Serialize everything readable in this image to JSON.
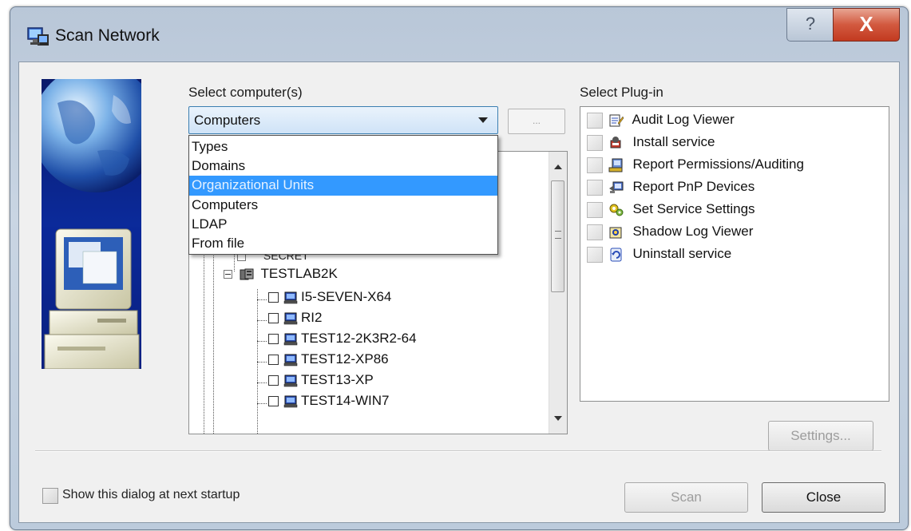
{
  "window": {
    "title": "Scan Network",
    "help_glyph": "?",
    "close_glyph": "X"
  },
  "computers": {
    "label": "Select computer(s)",
    "combo_value": "Computers",
    "browse_label": "...",
    "dropdown_options": [
      "Types",
      "Domains",
      "Organizational Units",
      "Computers",
      "LDAP",
      "From file"
    ],
    "selected_option": "Organizational Units",
    "tree": {
      "partial_node": "SECRET",
      "group": "TESTLAB2K",
      "computers": [
        "I5-SEVEN-X64",
        "RI2",
        "TEST12-2K3R2-64",
        "TEST12-XP86",
        "TEST13-XP",
        "TEST14-WIN7"
      ]
    }
  },
  "plugins": {
    "label": "Select Plug-in",
    "items": [
      {
        "label": "Audit Log Viewer",
        "icon": "audit-log-icon"
      },
      {
        "label": "Install service",
        "icon": "install-service-icon"
      },
      {
        "label": "Report Permissions/Auditing",
        "icon": "report-permissions-icon"
      },
      {
        "label": "Report PnP Devices",
        "icon": "report-pnp-icon"
      },
      {
        "label": "Set Service Settings",
        "icon": "service-settings-icon"
      },
      {
        "label": "Shadow Log Viewer",
        "icon": "shadow-log-icon"
      },
      {
        "label": "Uninstall service",
        "icon": "uninstall-service-icon"
      }
    ],
    "settings_label": "Settings..."
  },
  "footer": {
    "startup_label": "Show this dialog at next startup",
    "scan_label": "Scan",
    "close_label": "Close"
  },
  "colors": {
    "selection": "#3399ff",
    "title_close": "#c8452a",
    "banner": "#0b2a9a"
  }
}
